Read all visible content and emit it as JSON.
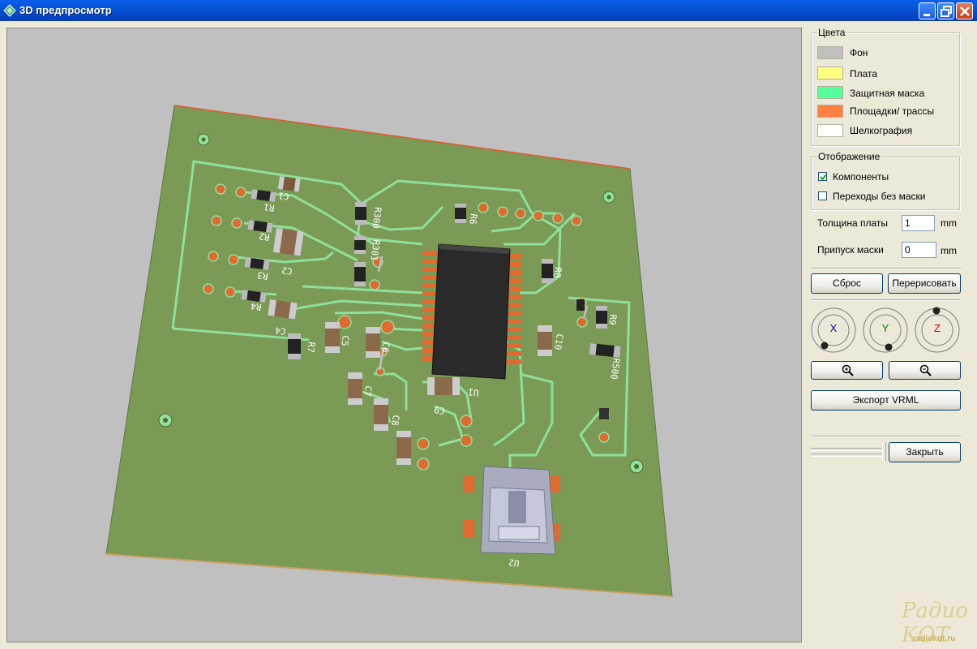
{
  "window": {
    "title": "3D предпросмотр",
    "icon": "app-diamond-icon",
    "controls": [
      "minimize-icon",
      "restore-icon",
      "close-icon"
    ]
  },
  "panel": {
    "colors_group": {
      "title": "Цвета",
      "items": [
        {
          "label": "Фон",
          "color": "#C0C0C0"
        },
        {
          "label": "Плата",
          "color": "#FFFF80"
        },
        {
          "label": "Защитная маска",
          "color": "#55FF99"
        },
        {
          "label": "Площадки/ трассы",
          "color": "#FF8040"
        },
        {
          "label": "Шелкография",
          "color": "#FFFFFF"
        }
      ]
    },
    "display_group": {
      "title": "Отображение",
      "components": {
        "label": "Компоненты",
        "checked": true
      },
      "vias": {
        "label": "Переходы без маски",
        "checked": false
      }
    },
    "board_thickness": {
      "label": "Толщина платы",
      "value": "1",
      "unit": "mm"
    },
    "mask_margin": {
      "label": "Припуск маски",
      "value": "0",
      "unit": "mm"
    },
    "reset_label": "Сброс",
    "redraw_label": "Перерисовать",
    "axes": [
      {
        "letter": "X",
        "color": "#0000CC"
      },
      {
        "letter": "Y",
        "color": "#008000"
      },
      {
        "letter": "Z",
        "color": "#CC0000"
      }
    ],
    "zoom_in_icon": "zoom-in-icon",
    "zoom_out_icon": "zoom-out-icon",
    "export_label": "Экспорт VRML",
    "close_label": "Закрыть"
  },
  "pcb": {
    "board_color": "#7A9A55",
    "mask_trace_color": "#8FE09A",
    "pad_color": "#E06A30",
    "ref_labels": [
      "C1",
      "R1",
      "R2",
      "C2",
      "R3",
      "R4",
      "C4",
      "R7",
      "C5",
      "C6",
      "C7",
      "C8",
      "C9",
      "U1",
      "R6",
      "R300",
      "R301",
      "R8",
      "R9",
      "C10",
      "R500",
      "U2"
    ]
  },
  "watermark": {
    "text": "Радио КОТ",
    "url": "radiokot.ru"
  }
}
